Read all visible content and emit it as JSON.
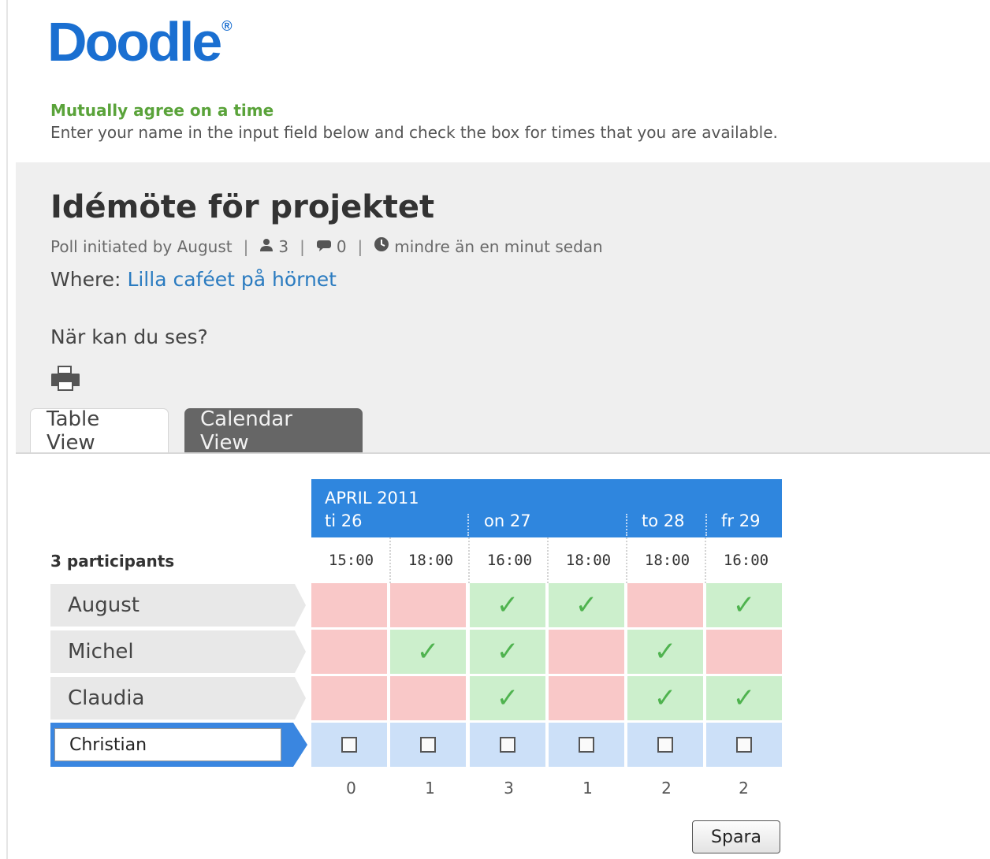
{
  "brand": {
    "logo_text": "Doodle",
    "registered_mark": "®",
    "logo_color": "#1a6fd1"
  },
  "intro": {
    "tagline": "Mutually agree on a time",
    "instructions": "Enter your name in the input field below and check the box for times that you are available."
  },
  "poll": {
    "title": "Idémöte för projektet",
    "initiated_by": "Poll initiated by August",
    "participants_count": "3",
    "comments_count": "0",
    "time_ago": "mindre än en minut sedan",
    "where_label": "Where:",
    "where_value": "Lilla caféet på hörnet",
    "question": "När kan du ses?"
  },
  "tabs": [
    {
      "label": "Table View",
      "active": true
    },
    {
      "label": "Calendar View",
      "active": false
    }
  ],
  "table": {
    "month": "APRIL 2011",
    "days": [
      "ti 26",
      "on 27",
      "to 28",
      "fr 29"
    ],
    "times": [
      "15:00",
      "18:00",
      "16:00",
      "18:00",
      "18:00",
      "16:00"
    ],
    "participants_label": "3 participants",
    "participants": [
      {
        "name": "August",
        "availability": [
          "no",
          "no",
          "yes",
          "yes",
          "no",
          "yes"
        ]
      },
      {
        "name": "Michel",
        "availability": [
          "no",
          "yes",
          "yes",
          "no",
          "yes",
          "no"
        ]
      },
      {
        "name": "Claudia",
        "availability": [
          "no",
          "no",
          "yes",
          "no",
          "yes",
          "yes"
        ]
      }
    ],
    "new_participant_name": "Christian",
    "counts": [
      "0",
      "1",
      "3",
      "1",
      "2",
      "2"
    ],
    "check_symbol": "✓"
  },
  "actions": {
    "save_label": "Spara"
  },
  "colors": {
    "header_blue": "#2f86de",
    "no": "#f9c8c8",
    "yes": "#ccefcc",
    "new_row": "#cce0f8",
    "tagline_green": "#5aa33a"
  }
}
